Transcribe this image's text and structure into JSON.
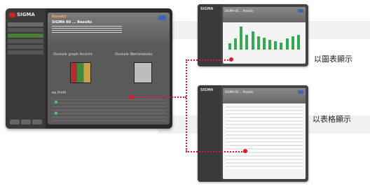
{
  "app": {
    "brand": "SIGMA"
  },
  "main": {
    "title": "Results",
    "subtitle": "SIGMA 60 ... Results",
    "option_graph": "Ouskaik graph Ansicht",
    "option_table": "Ouskaik Wertetabelle",
    "section": "ee Profil"
  },
  "graph_shot": {
    "title": "SIGMA 60 ... Results",
    "bars": [
      0.25,
      0.45,
      0.95,
      0.6,
      0.75,
      0.55,
      0.5,
      0.4,
      0.35,
      0.3,
      0.45,
      0.55,
      0.6
    ]
  },
  "table_shot": {
    "title": "SIGMA 60 ... Results"
  },
  "labels": {
    "graph": "以圖表顯示",
    "table": "以表格顯示"
  },
  "colors": {
    "accent": "#e0182d",
    "bars": "#34a853"
  }
}
